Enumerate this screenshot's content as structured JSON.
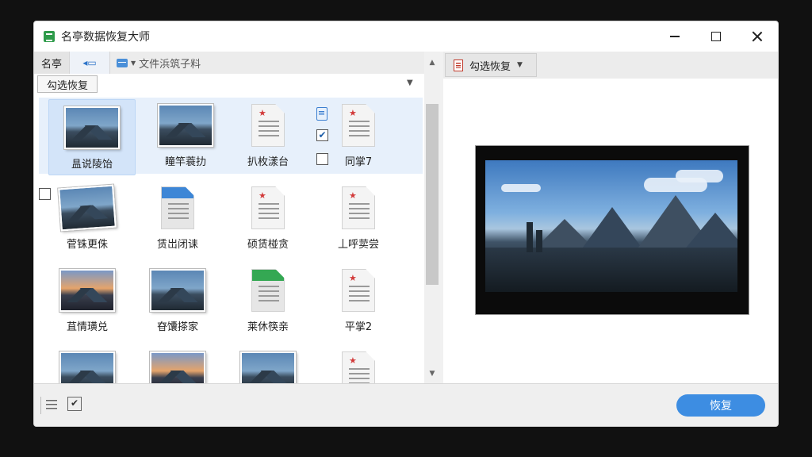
{
  "window": {
    "title": "名亭数据恢复大师"
  },
  "path_bar": {
    "name_label": "名亭",
    "back_label": "",
    "crumb": "文件浜筑子料"
  },
  "filter": {
    "label": "勾选恢复"
  },
  "files": [
    {
      "label": "昷说陵饴",
      "type": "photo",
      "selected": true
    },
    {
      "label": "瞳竿蓑扐",
      "type": "photo"
    },
    {
      "label": "扒枚漾台",
      "type": "doc-red"
    },
    {
      "label": "同掌7",
      "type": "doc-red",
      "checked": true
    },
    {
      "label": "菅铢更侏",
      "type": "photo-tilted",
      "checked": false
    },
    {
      "label": "赁岀闭诔",
      "type": "doc-blue"
    },
    {
      "label": "硕赁椪贪",
      "type": "doc-red"
    },
    {
      "label": "丄呼荬尝",
      "type": "doc-red"
    },
    {
      "label": "苴情璜兑",
      "type": "photo-stack"
    },
    {
      "label": "昚馕搽家",
      "type": "photo-doc"
    },
    {
      "label": "莱休筷亲",
      "type": "doc-green"
    },
    {
      "label": "平掌2",
      "type": "doc-red"
    }
  ],
  "preview_toolbar": {
    "label": "勾选恢复"
  },
  "bottom": {
    "recover_label": "恢复"
  },
  "colors": {
    "accent": "#3d8de2",
    "selection": "#d3e4f9"
  }
}
